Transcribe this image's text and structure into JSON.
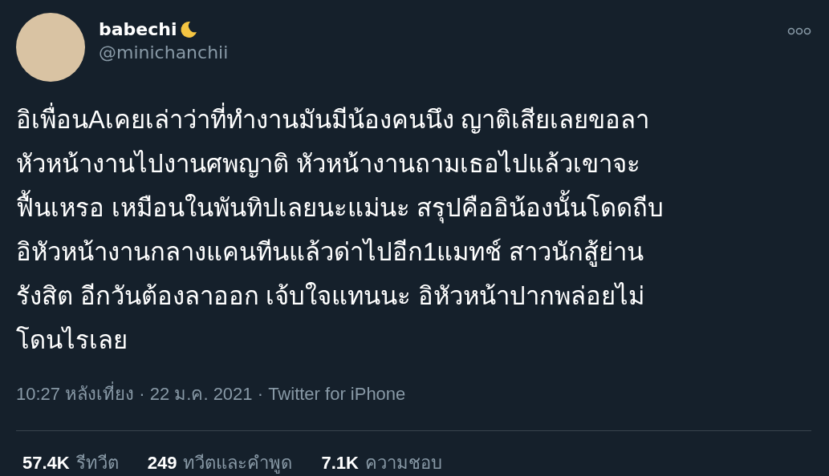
{
  "author": {
    "name": "babechi",
    "handle": "@minichanchii"
  },
  "tweet": {
    "text": "อิเพื่อนAเคยเล่าว่าที่ทำงานมันมีน้องคนนึง ญาติเสียเลยขอลา\nหัวหน้างานไปงานศพญาติ หัวหน้างานถามเธอไปแล้วเขาจะ\nฟื้นเหรอ เหมือนในพันทิปเลยนะแม่นะ สรุปคืออิน้องนั้นโดดถีบ\nอิหัวหน้างานกลางแคนทีนแล้วด่าไปอีก1แมทช์ สาวนักสู้ย่าน\nรังสิต อีกวันต้องลาออก เจ้บใจแทนนะ อิหัวหน้าปากพล่อยไม่\nโดนไรเลย",
    "meta": "10:27 หลังเที่ยง · 22 ม.ค. 2021 · Twitter for iPhone"
  },
  "stats": [
    {
      "count": "57.4K",
      "label": "รีทวีต"
    },
    {
      "count": "249",
      "label": "ทวีตและคำพูด"
    },
    {
      "count": "7.1K",
      "label": "ความชอบ"
    }
  ]
}
